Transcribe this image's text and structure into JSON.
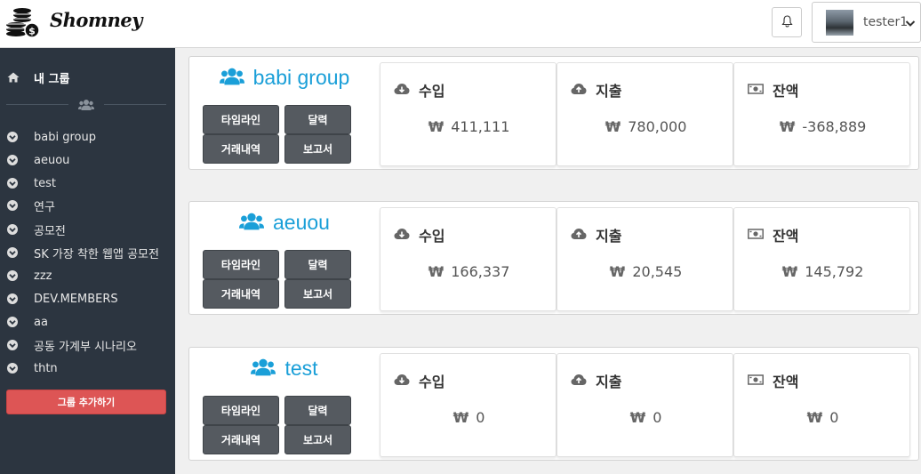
{
  "header": {
    "logo_text": "Shomney",
    "user_name": "tester1"
  },
  "sidebar": {
    "title": "내 그룹",
    "items": [
      {
        "label": "babi group"
      },
      {
        "label": "aeuou"
      },
      {
        "label": "test"
      },
      {
        "label": "연구"
      },
      {
        "label": "공모전"
      },
      {
        "label": "SK 가장 착한 웹앱 공모전"
      },
      {
        "label": "zzz"
      },
      {
        "label": "DEV.MEMBERS"
      },
      {
        "label": "aa"
      },
      {
        "label": "공동 가계부 시나리오"
      },
      {
        "label": "thtn"
      }
    ],
    "add_button": "그룹 추가하기"
  },
  "labels": {
    "timeline": "타임라인",
    "calendar": "달력",
    "transactions": "거래내역",
    "report": "보고서",
    "income": "수입",
    "expense": "지출",
    "balance": "잔액",
    "currency": "₩"
  },
  "groups": [
    {
      "name": "babi group",
      "income": "411,111",
      "expense": "780,000",
      "balance": "-368,889"
    },
    {
      "name": "aeuou",
      "income": "166,337",
      "expense": "20,545",
      "balance": "145,792"
    },
    {
      "name": "test",
      "income": "0",
      "expense": "0",
      "balance": "0"
    }
  ],
  "colors": {
    "accent": "#1a9fd8",
    "sidebar_bg": "#2c3540",
    "add_button": "#dd5555",
    "button_dark": "#555a60"
  }
}
